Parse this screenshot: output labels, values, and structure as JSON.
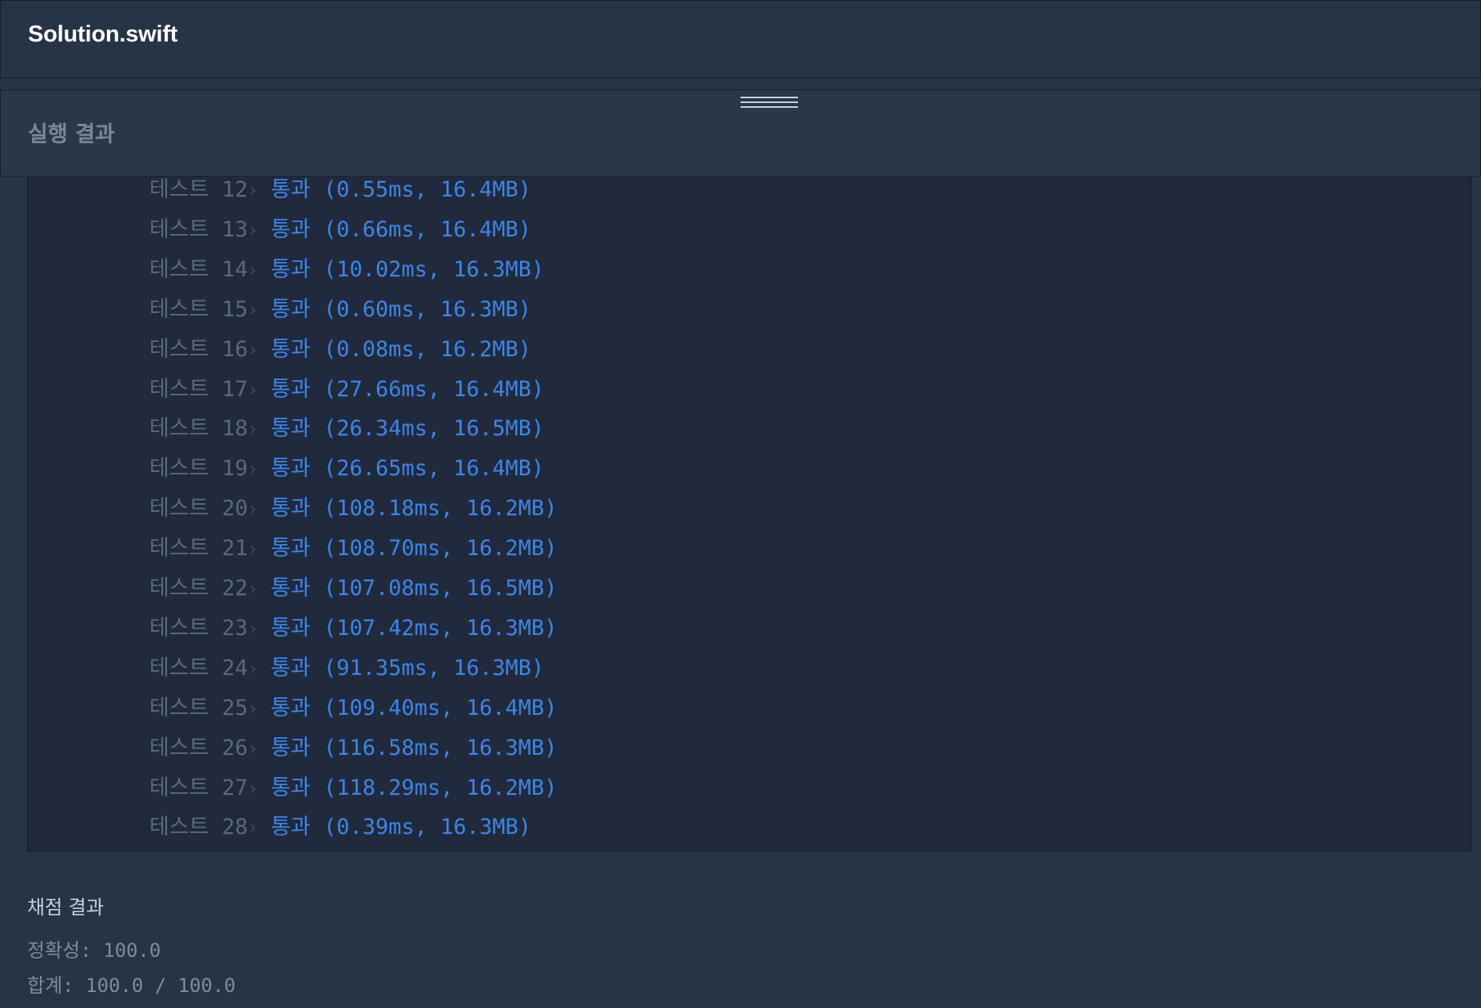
{
  "file": {
    "title": "Solution.swift"
  },
  "results": {
    "title": "실행 결과",
    "tests": [
      {
        "label": "테스트 12",
        "status": "통과",
        "detail": "(0.55ms, 16.4MB)"
      },
      {
        "label": "테스트 13",
        "status": "통과",
        "detail": "(0.66ms, 16.4MB)"
      },
      {
        "label": "테스트 14",
        "status": "통과",
        "detail": "(10.02ms, 16.3MB)"
      },
      {
        "label": "테스트 15",
        "status": "통과",
        "detail": "(0.60ms, 16.3MB)"
      },
      {
        "label": "테스트 16",
        "status": "통과",
        "detail": "(0.08ms, 16.2MB)"
      },
      {
        "label": "테스트 17",
        "status": "통과",
        "detail": "(27.66ms, 16.4MB)"
      },
      {
        "label": "테스트 18",
        "status": "통과",
        "detail": "(26.34ms, 16.5MB)"
      },
      {
        "label": "테스트 19",
        "status": "통과",
        "detail": "(26.65ms, 16.4MB)"
      },
      {
        "label": "테스트 20",
        "status": "통과",
        "detail": "(108.18ms, 16.2MB)"
      },
      {
        "label": "테스트 21",
        "status": "통과",
        "detail": "(108.70ms, 16.2MB)"
      },
      {
        "label": "테스트 22",
        "status": "통과",
        "detail": "(107.08ms, 16.5MB)"
      },
      {
        "label": "테스트 23",
        "status": "통과",
        "detail": "(107.42ms, 16.3MB)"
      },
      {
        "label": "테스트 24",
        "status": "통과",
        "detail": "(91.35ms, 16.3MB)"
      },
      {
        "label": "테스트 25",
        "status": "통과",
        "detail": "(109.40ms, 16.4MB)"
      },
      {
        "label": "테스트 26",
        "status": "통과",
        "detail": "(116.58ms, 16.3MB)"
      },
      {
        "label": "테스트 27",
        "status": "통과",
        "detail": "(118.29ms, 16.2MB)"
      },
      {
        "label": "테스트 28",
        "status": "통과",
        "detail": "(0.39ms, 16.3MB)"
      }
    ]
  },
  "grading": {
    "title": "채점 결과",
    "accuracy": "정확성: 100.0",
    "total": "합계: 100.0 / 100.0"
  },
  "colors": {
    "background": "#263445",
    "test_panel": "#212a3d",
    "pass_text": "#3d85e6",
    "label_text": "#5c6878"
  },
  "icons": {
    "drag_handle": "drag-handle-icon",
    "separator": "chevron-right-icon"
  }
}
